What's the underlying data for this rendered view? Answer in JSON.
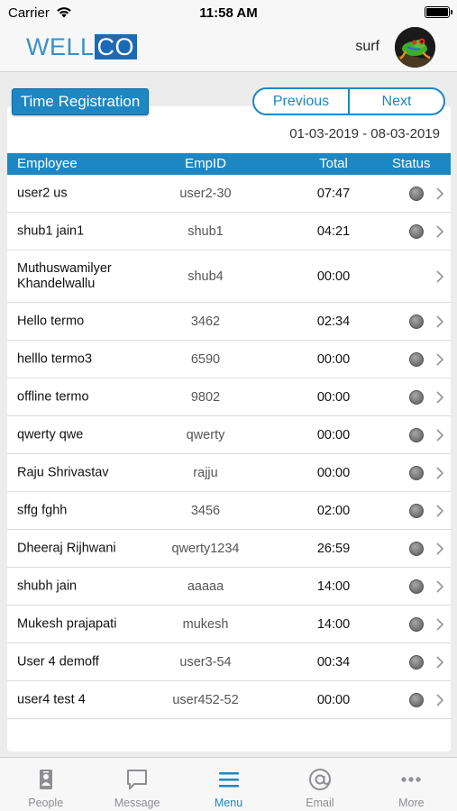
{
  "status_bar": {
    "carrier": "Carrier",
    "time": "11:58 AM"
  },
  "header": {
    "logo_part1": "WELL",
    "logo_part2": "CO",
    "username": "surf"
  },
  "page": {
    "title": "Time Registration",
    "previous_label": "Previous",
    "next_label": "Next",
    "date_range": "01-03-2019 - 08-03-2019"
  },
  "table": {
    "columns": {
      "employee": "Employee",
      "empid": "EmpID",
      "total": "Total",
      "status": "Status"
    },
    "rows": [
      {
        "employee": "user2 us",
        "empid": "user2-30",
        "total": "07:47",
        "status_dot": true
      },
      {
        "employee": "shub1 jain1",
        "empid": "shub1",
        "total": "04:21",
        "status_dot": true
      },
      {
        "employee": "Muthuswamilyer Khandelwallu",
        "empid": "shub4",
        "total": "00:00",
        "status_dot": false
      },
      {
        "employee": "Hello termo",
        "empid": "3462",
        "total": "02:34",
        "status_dot": true
      },
      {
        "employee": "helllo termo3",
        "empid": "6590",
        "total": "00:00",
        "status_dot": true
      },
      {
        "employee": "offline termo",
        "empid": "9802",
        "total": "00:00",
        "status_dot": true
      },
      {
        "employee": "qwerty qwe",
        "empid": "qwerty",
        "total": "00:00",
        "status_dot": true
      },
      {
        "employee": "Raju Shrivastav",
        "empid": "rajju",
        "total": "00:00",
        "status_dot": true
      },
      {
        "employee": "sffg fghh",
        "empid": "3456",
        "total": "02:00",
        "status_dot": true
      },
      {
        "employee": "Dheeraj Rijhwani",
        "empid": "qwerty1234",
        "total": "26:59",
        "status_dot": true
      },
      {
        "employee": "shubh jain",
        "empid": "aaaaa",
        "total": "14:00",
        "status_dot": true
      },
      {
        "employee": "Mukesh prajapati",
        "empid": "mukesh",
        "total": "14:00",
        "status_dot": true
      },
      {
        "employee": "User 4 demoff",
        "empid": "user3-54",
        "total": "00:34",
        "status_dot": true
      },
      {
        "employee": "user4 test 4",
        "empid": "user452-52",
        "total": "00:00",
        "status_dot": true
      }
    ]
  },
  "tabbar": {
    "items": [
      {
        "label": "People",
        "icon": "people-icon",
        "active": false
      },
      {
        "label": "Message",
        "icon": "message-icon",
        "active": false
      },
      {
        "label": "Menu",
        "icon": "menu-icon",
        "active": true
      },
      {
        "label": "Email",
        "icon": "email-icon",
        "active": false
      },
      {
        "label": "More",
        "icon": "more-icon",
        "active": false
      }
    ]
  },
  "colors": {
    "accent": "#1d87c4",
    "status_dot": "#7a7a7a",
    "inactive_tab": "#8e8e93"
  }
}
